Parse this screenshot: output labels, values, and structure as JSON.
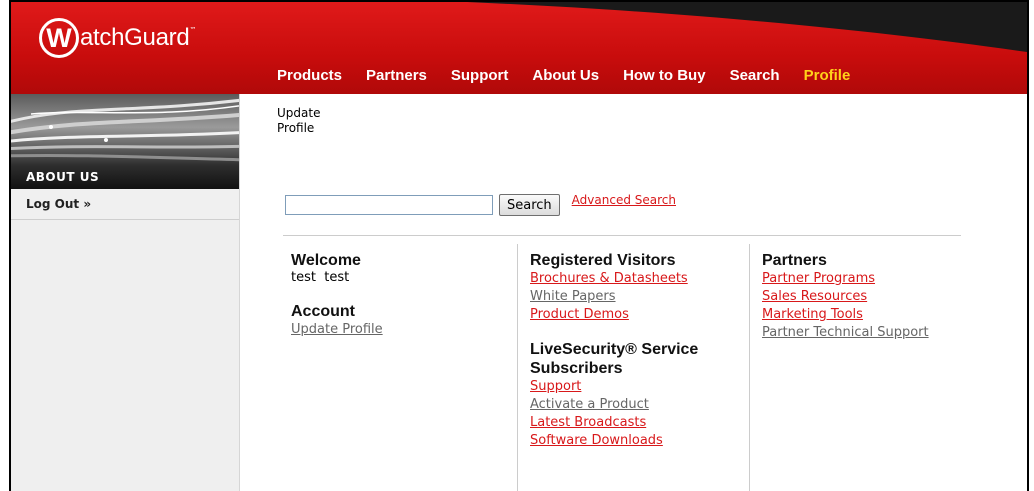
{
  "logo": {
    "letter": "W",
    "text": "atchGuard",
    "tm": "™"
  },
  "topnav": [
    {
      "label": "Products",
      "active": false
    },
    {
      "label": "Partners",
      "active": false
    },
    {
      "label": "Support",
      "active": false
    },
    {
      "label": "About Us",
      "active": false
    },
    {
      "label": "How to Buy",
      "active": false
    },
    {
      "label": "Search",
      "active": false
    },
    {
      "label": "Profile",
      "active": true
    }
  ],
  "sidebar": {
    "caption": "ABOUT US",
    "logout": "Log Out »"
  },
  "breadcrumb": {
    "line1": "Update",
    "line2": "Profile"
  },
  "search": {
    "value": "",
    "button": "Search",
    "advanced": "Advanced Search"
  },
  "col_welcome": {
    "title": "Welcome",
    "user": "test  test",
    "account_title": "Account",
    "update_profile": "Update Profile"
  },
  "col_registered": {
    "title": "Registered Visitors",
    "links": [
      "Brochures & Datasheets",
      "White Papers",
      "Product Demos"
    ],
    "live_title": "LiveSecurity® Service Subscribers",
    "live_links": [
      "Support",
      "Activate a Product",
      "Latest Broadcasts",
      "Software Downloads"
    ]
  },
  "col_partners": {
    "title": "Partners",
    "links": [
      "Partner Programs",
      "Sales Resources",
      "Marketing Tools",
      "Partner Technical Support"
    ]
  },
  "colors": {
    "brand_red": "#d8181a",
    "active_nav": "#ffd21a"
  }
}
